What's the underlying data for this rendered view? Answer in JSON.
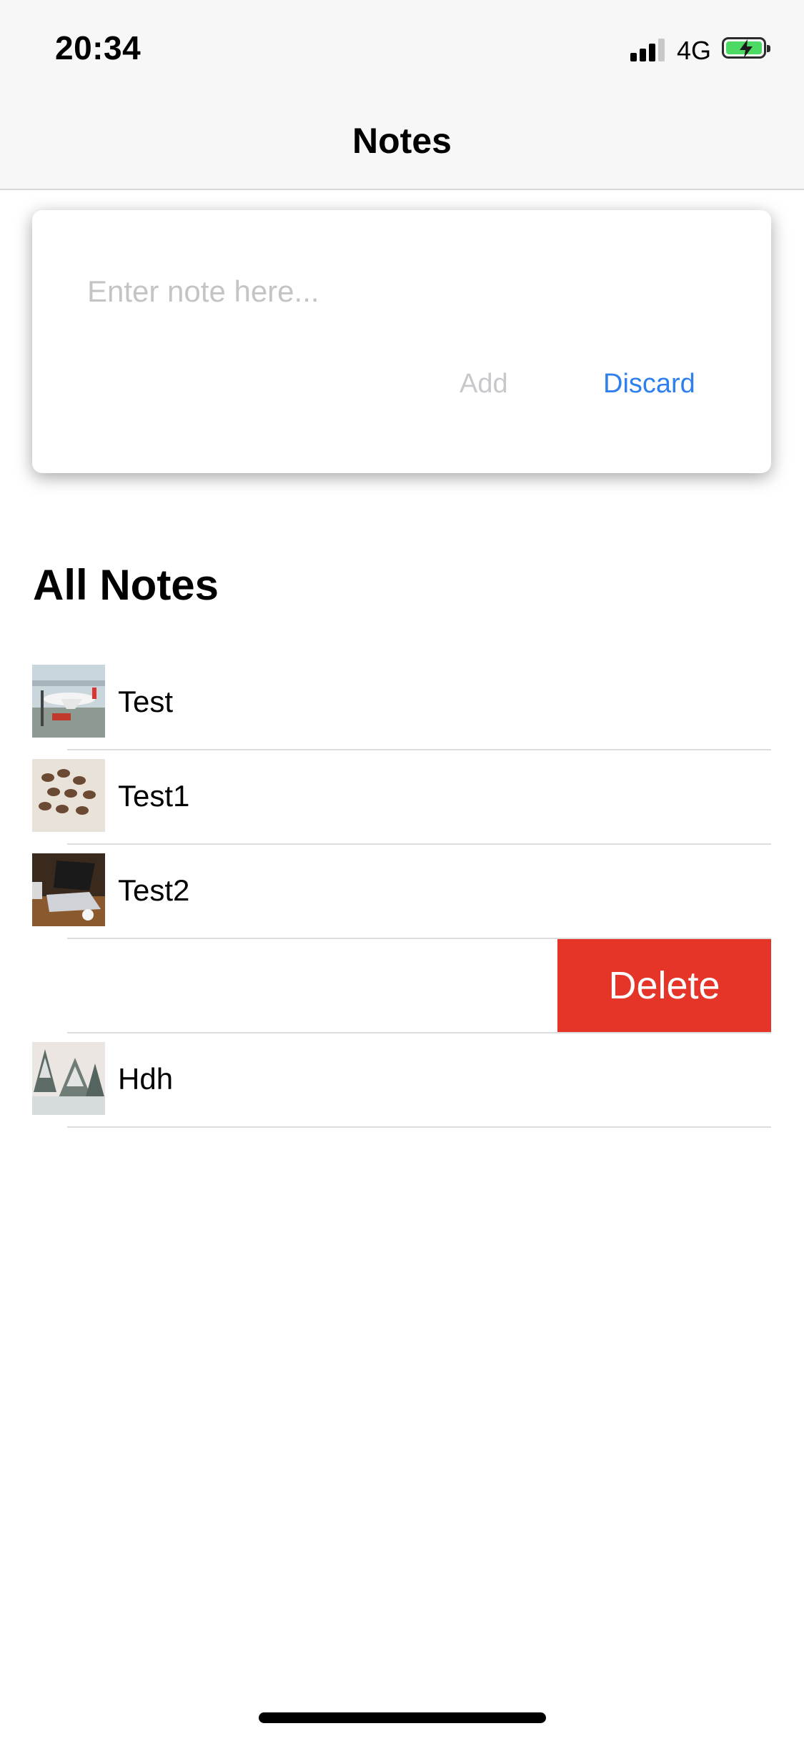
{
  "status_bar": {
    "time": "20:34",
    "network": "4G"
  },
  "nav": {
    "title": "Notes"
  },
  "compose": {
    "placeholder": "Enter note here...",
    "value": "",
    "add_label": "Add",
    "discard_label": "Discard"
  },
  "section": {
    "title": "All Notes"
  },
  "notes": [
    {
      "label": "Test",
      "thumbnail": "airplane-photo"
    },
    {
      "label": "Test1",
      "thumbnail": "coffee-beans-photo"
    },
    {
      "label": "Test2",
      "thumbnail": "laptop-photo"
    },
    {
      "label": "",
      "swiped": true,
      "action_label": "Delete"
    },
    {
      "label": "Hdh",
      "thumbnail": "snowy-trees-photo"
    }
  ],
  "colors": {
    "accent": "#2f80ed",
    "delete": "#e53528",
    "disabled": "#c7c7cc",
    "battery": "#4cd964"
  }
}
